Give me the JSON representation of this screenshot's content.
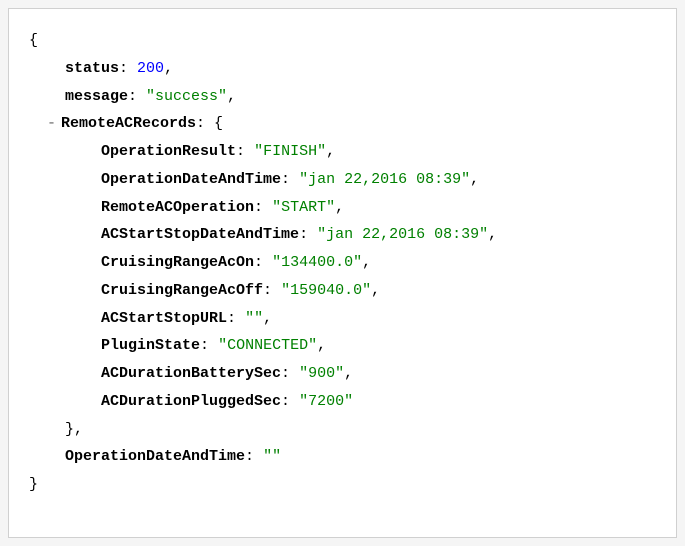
{
  "json": {
    "collapse_symbol": "-",
    "status_key": "status",
    "status_value": "200",
    "message_key": "message",
    "message_value": "\"success\"",
    "remote_ac_key": "RemoteACRecords",
    "operation_result_key": "OperationResult",
    "operation_result_value": "\"FINISH\"",
    "operation_date_key": "OperationDateAndTime",
    "operation_date_value": "\"jan 22,2016 08:39\"",
    "remote_ac_operation_key": "RemoteACOperation",
    "remote_ac_operation_value": "\"START\"",
    "ac_start_stop_date_key": "ACStartStopDateAndTime",
    "ac_start_stop_date_value": "\"jan 22,2016 08:39\"",
    "cruising_range_on_key": "CruisingRangeAcOn",
    "cruising_range_on_value": "\"134400.0\"",
    "cruising_range_off_key": "CruisingRangeAcOff",
    "cruising_range_off_value": "\"159040.0\"",
    "ac_start_stop_url_key": "ACStartStopURL",
    "ac_start_stop_url_value": "\"\"",
    "plugin_state_key": "PluginState",
    "plugin_state_value": "\"CONNECTED\"",
    "ac_duration_battery_key": "ACDurationBatterySec",
    "ac_duration_battery_value": "\"900\"",
    "ac_duration_plugged_key": "ACDurationPluggedSec",
    "ac_duration_plugged_value": "\"7200\"",
    "outer_operation_date_key": "OperationDateAndTime",
    "outer_operation_date_value": "\"\""
  }
}
